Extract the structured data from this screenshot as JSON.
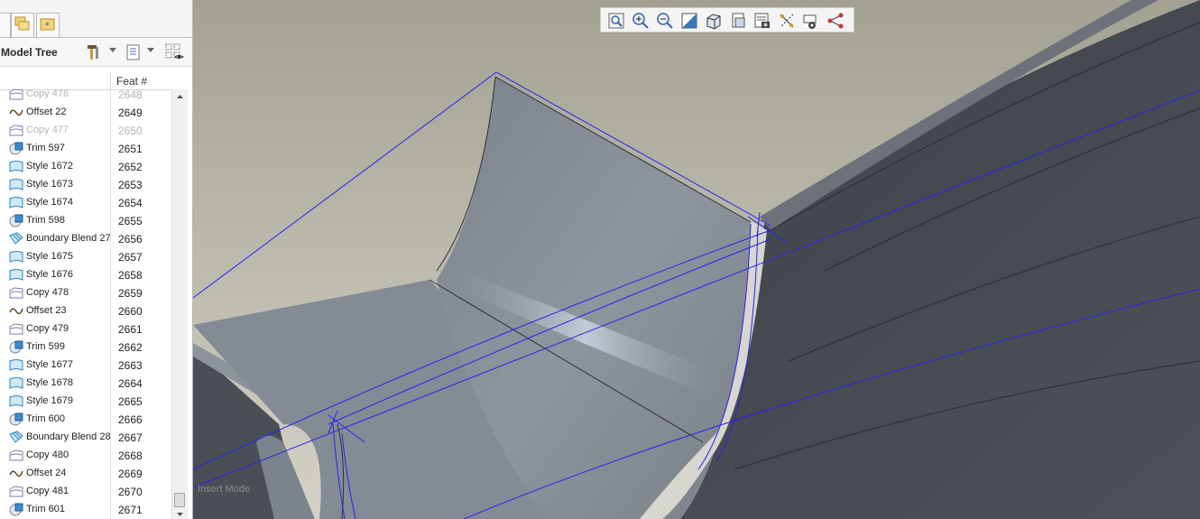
{
  "model_tree": {
    "title": "Model Tree",
    "column_header": "Feat #",
    "rows": [
      {
        "name": "Copy 476",
        "feat": "2648",
        "icon": "copy-icon",
        "dim": true
      },
      {
        "name": "Offset 22",
        "feat": "2649",
        "icon": "offset-icon",
        "dim": false
      },
      {
        "name": "Copy 477",
        "feat": "2650",
        "icon": "copy-icon",
        "dim": true
      },
      {
        "name": "Trim 597",
        "feat": "2651",
        "icon": "trim-icon",
        "dim": false
      },
      {
        "name": "Style 1672",
        "feat": "2652",
        "icon": "style-icon",
        "dim": false
      },
      {
        "name": "Style 1673",
        "feat": "2653",
        "icon": "style-icon",
        "dim": false
      },
      {
        "name": "Style 1674",
        "feat": "2654",
        "icon": "style-icon",
        "dim": false
      },
      {
        "name": "Trim 598",
        "feat": "2655",
        "icon": "trim-icon",
        "dim": false
      },
      {
        "name": "Boundary Blend 27",
        "feat": "2656",
        "icon": "boundary-blend-icon",
        "dim": false
      },
      {
        "name": "Style 1675",
        "feat": "2657",
        "icon": "style-icon",
        "dim": false
      },
      {
        "name": "Style 1676",
        "feat": "2658",
        "icon": "style-icon",
        "dim": false
      },
      {
        "name": "Copy 478",
        "feat": "2659",
        "icon": "copy-icon",
        "dim": false
      },
      {
        "name": "Offset 23",
        "feat": "2660",
        "icon": "offset-icon",
        "dim": false
      },
      {
        "name": "Copy 479",
        "feat": "2661",
        "icon": "copy-icon",
        "dim": false
      },
      {
        "name": "Trim 599",
        "feat": "2662",
        "icon": "trim-icon",
        "dim": false
      },
      {
        "name": "Style 1677",
        "feat": "2663",
        "icon": "style-icon",
        "dim": false
      },
      {
        "name": "Style 1678",
        "feat": "2664",
        "icon": "style-icon",
        "dim": false
      },
      {
        "name": "Style 1679",
        "feat": "2665",
        "icon": "style-icon",
        "dim": false
      },
      {
        "name": "Trim 600",
        "feat": "2666",
        "icon": "trim-icon",
        "dim": false
      },
      {
        "name": "Boundary Blend 28",
        "feat": "2667",
        "icon": "boundary-blend-icon",
        "dim": false
      },
      {
        "name": "Copy 480",
        "feat": "2668",
        "icon": "copy-icon",
        "dim": false
      },
      {
        "name": "Offset 24",
        "feat": "2669",
        "icon": "offset-icon",
        "dim": false
      },
      {
        "name": "Copy 481",
        "feat": "2670",
        "icon": "copy-icon",
        "dim": false
      },
      {
        "name": "Trim 601",
        "feat": "2671",
        "icon": "trim-icon",
        "dim": false
      }
    ]
  },
  "viewport": {
    "status_text": "Insert Mode",
    "toolbar_icons": [
      "refit-icon",
      "zoom-in-icon",
      "zoom-out-icon",
      "repaint-icon",
      "display-style-icon",
      "saved-views-icon",
      "view-manager-icon",
      "datum-display-icon",
      "annotation-display-icon",
      "spin-center-icon"
    ]
  },
  "colors": {
    "background_top": "#a3a292",
    "background_bottom": "#d4d2c6",
    "model_face": "#7d838c",
    "model_dark": "#3f4249",
    "curve_blue": "#2a22f0"
  }
}
